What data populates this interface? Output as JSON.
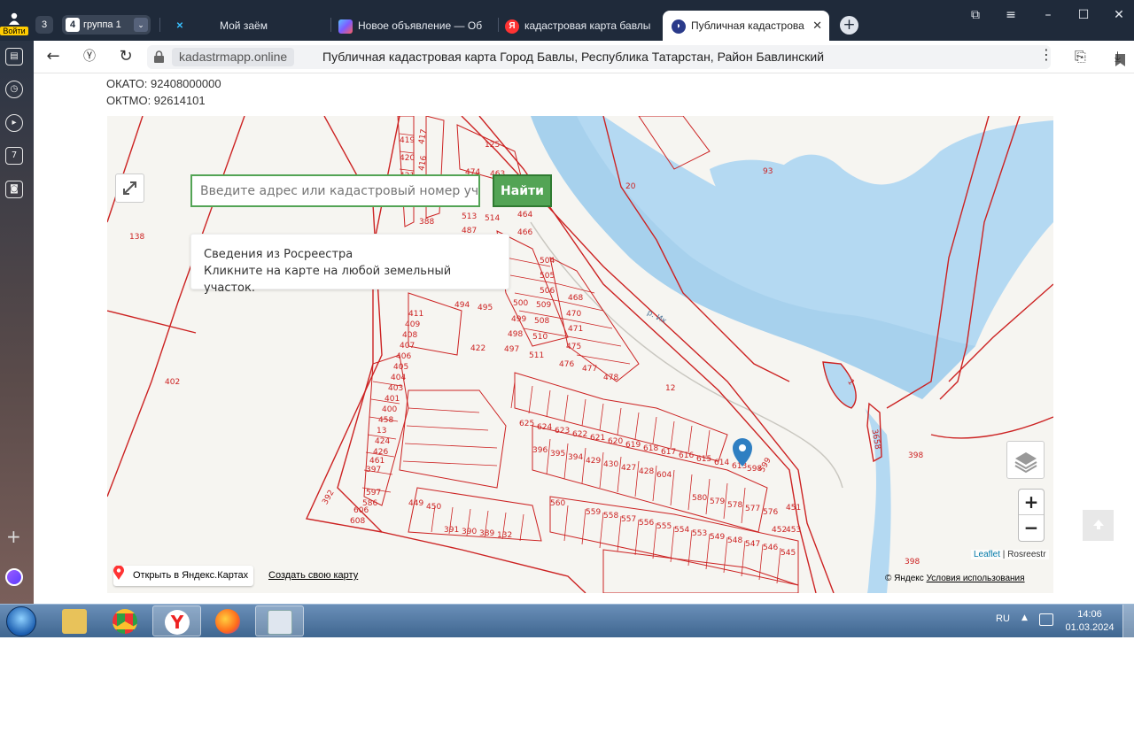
{
  "browser": {
    "login_label": "Войти",
    "tab_count": "3",
    "group": {
      "number": "4",
      "label": "группа 1"
    },
    "tabs": [
      {
        "label": "Мой заём",
        "favicon": "loan-icon"
      },
      {
        "label": "Новое объявление — Об",
        "favicon": "ads-icon"
      },
      {
        "label": "кадастровая карта бавлы",
        "favicon": "yandex-icon"
      },
      {
        "label": "Публичная кадастрова",
        "favicon": "cadastre-icon",
        "active": true
      }
    ],
    "address": {
      "domain": "kadastrmapp.online",
      "title": "Публичная кадастровая карта Город Бавлы, Республика Татарстан, Район Бавлинский"
    }
  },
  "page": {
    "okato": "ОКАТО: 92408000000",
    "oktmo": "ОКТМО: 92614101",
    "search": {
      "placeholder": "Введите адрес или кадастровый номер участка",
      "button": "Найти"
    },
    "info": {
      "title": "Сведения из Росреестра",
      "text": "Кликните на карте на любой земельный участок."
    },
    "map": {
      "zoom_in": "+",
      "zoom_out": "−",
      "attribution_leaflet": "Leaflet",
      "attribution_sep": " | ",
      "attribution_rosreestr": "Rosreestr",
      "open_yandex": "Открыть в Яндекс.Картах",
      "create_map": "Создать свою карту",
      "copyright": "© Яндекс ",
      "terms": "Условия использования",
      "river_label": "р. Ик",
      "plots": [
        {
          "n": "419"
        },
        {
          "n": "420"
        },
        {
          "n": "421"
        },
        {
          "n": "416"
        },
        {
          "n": "417"
        },
        {
          "n": "418"
        },
        {
          "n": "125"
        },
        {
          "n": "474"
        },
        {
          "n": "463"
        },
        {
          "n": "388"
        },
        {
          "n": "513"
        },
        {
          "n": "514"
        },
        {
          "n": "487"
        },
        {
          "n": "488"
        },
        {
          "n": "464"
        },
        {
          "n": "466"
        },
        {
          "n": "465"
        },
        {
          "n": "138"
        },
        {
          "n": "20"
        },
        {
          "n": "93"
        },
        {
          "n": "504"
        },
        {
          "n": "505"
        },
        {
          "n": "506"
        },
        {
          "n": "467"
        },
        {
          "n": "500"
        },
        {
          "n": "509"
        },
        {
          "n": "468"
        },
        {
          "n": "494"
        },
        {
          "n": "495"
        },
        {
          "n": "499"
        },
        {
          "n": "508"
        },
        {
          "n": "470"
        },
        {
          "n": "411"
        },
        {
          "n": "409"
        },
        {
          "n": "469"
        },
        {
          "n": "471"
        },
        {
          "n": "408"
        },
        {
          "n": "498"
        },
        {
          "n": "510"
        },
        {
          "n": "472"
        },
        {
          "n": "407"
        },
        {
          "n": "497"
        },
        {
          "n": "511"
        },
        {
          "n": "475"
        },
        {
          "n": "473"
        },
        {
          "n": "406"
        },
        {
          "n": "422"
        },
        {
          "n": "405"
        },
        {
          "n": "476"
        },
        {
          "n": "477"
        },
        {
          "n": "479"
        },
        {
          "n": "404"
        },
        {
          "n": "423"
        },
        {
          "n": "478"
        },
        {
          "n": "480"
        },
        {
          "n": "403"
        },
        {
          "n": "434"
        },
        {
          "n": "445"
        },
        {
          "n": "456"
        },
        {
          "n": "532"
        },
        {
          "n": "530"
        },
        {
          "n": "528"
        },
        {
          "n": "481"
        },
        {
          "n": "12"
        },
        {
          "n": "1"
        },
        {
          "n": "402"
        },
        {
          "n": "401"
        },
        {
          "n": "400"
        },
        {
          "n": "458"
        },
        {
          "n": "459"
        },
        {
          "n": "460"
        },
        {
          "n": "625"
        },
        {
          "n": "624"
        },
        {
          "n": "623"
        },
        {
          "n": "622"
        },
        {
          "n": "621"
        },
        {
          "n": "620"
        },
        {
          "n": "619"
        },
        {
          "n": "618"
        },
        {
          "n": "617"
        },
        {
          "n": "616"
        },
        {
          "n": "615"
        },
        {
          "n": "614"
        },
        {
          "n": "613"
        },
        {
          "n": "612"
        },
        {
          "n": "611"
        },
        {
          "n": "626"
        },
        {
          "n": "627"
        },
        {
          "n": "628"
        },
        {
          "n": "521"
        },
        {
          "n": "522"
        },
        {
          "n": "523"
        },
        {
          "n": "524"
        },
        {
          "n": "525"
        },
        {
          "n": "526"
        },
        {
          "n": "527"
        },
        {
          "n": "529"
        },
        {
          "n": "531"
        },
        {
          "n": "13"
        },
        {
          "n": "3658"
        },
        {
          "n": "398"
        },
        {
          "n": "462"
        },
        {
          "n": "424"
        },
        {
          "n": "426"
        },
        {
          "n": "461"
        },
        {
          "n": "397"
        },
        {
          "n": "396"
        },
        {
          "n": "395"
        },
        {
          "n": "394"
        },
        {
          "n": "429"
        },
        {
          "n": "430"
        },
        {
          "n": "427"
        },
        {
          "n": "428"
        },
        {
          "n": "604"
        },
        {
          "n": "603"
        },
        {
          "n": "602"
        },
        {
          "n": "601"
        },
        {
          "n": "600"
        },
        {
          "n": "599"
        },
        {
          "n": "598"
        },
        {
          "n": "597"
        },
        {
          "n": "586"
        },
        {
          "n": "606"
        },
        {
          "n": "608"
        },
        {
          "n": "392"
        },
        {
          "n": "391"
        },
        {
          "n": "390"
        },
        {
          "n": "389"
        },
        {
          "n": "132"
        },
        {
          "n": "437"
        },
        {
          "n": "438"
        },
        {
          "n": "439"
        },
        {
          "n": "440"
        },
        {
          "n": "441"
        },
        {
          "n": "442"
        },
        {
          "n": "443"
        },
        {
          "n": "444"
        },
        {
          "n": "435"
        },
        {
          "n": "436"
        },
        {
          "n": "446"
        },
        {
          "n": "581"
        },
        {
          "n": "580"
        },
        {
          "n": "579"
        },
        {
          "n": "578"
        },
        {
          "n": "577"
        },
        {
          "n": "576"
        },
        {
          "n": "575"
        },
        {
          "n": "574"
        },
        {
          "n": "573"
        },
        {
          "n": "572"
        },
        {
          "n": "571"
        },
        {
          "n": "570"
        },
        {
          "n": "592"
        },
        {
          "n": "591"
        },
        {
          "n": "590"
        },
        {
          "n": "589"
        },
        {
          "n": "588"
        },
        {
          "n": "587"
        },
        {
          "n": "569"
        },
        {
          "n": "568"
        },
        {
          "n": "567"
        },
        {
          "n": "447"
        },
        {
          "n": "448"
        },
        {
          "n": "449"
        },
        {
          "n": "450"
        },
        {
          "n": "451"
        },
        {
          "n": "452"
        },
        {
          "n": "453"
        },
        {
          "n": "454"
        },
        {
          "n": "455"
        },
        {
          "n": "639"
        },
        {
          "n": "566"
        },
        {
          "n": "565"
        },
        {
          "n": "564"
        },
        {
          "n": "563"
        },
        {
          "n": "562"
        },
        {
          "n": "561"
        },
        {
          "n": "560"
        },
        {
          "n": "559"
        },
        {
          "n": "558"
        },
        {
          "n": "557"
        },
        {
          "n": "556"
        },
        {
          "n": "555"
        },
        {
          "n": "554"
        },
        {
          "n": "553"
        },
        {
          "n": "549"
        },
        {
          "n": "548"
        },
        {
          "n": "547"
        },
        {
          "n": "546"
        },
        {
          "n": "545"
        },
        {
          "n": "544"
        },
        {
          "n": "543"
        },
        {
          "n": "542"
        },
        {
          "n": "541"
        },
        {
          "n": "540"
        },
        {
          "n": "539"
        },
        {
          "n": "538"
        },
        {
          "n": "537"
        },
        {
          "n": "536"
        },
        {
          "n": "535"
        },
        {
          "n": "551"
        },
        {
          "n": "550"
        },
        {
          "n": "534"
        },
        {
          "n": "533"
        },
        {
          "n": "531"
        },
        {
          "n": "520"
        },
        {
          "n": "422"
        }
      ]
    }
  },
  "taskbar": {
    "lang": "RU",
    "time": "14:06",
    "date": "01.03.2024",
    "apps": [
      "explorer-icon",
      "chrome-icon",
      "yandex-browser-icon",
      "firefox-icon",
      "calculator-icon"
    ]
  },
  "colors": {
    "plot_line": "#cc2222",
    "water": "#b4d9f2",
    "accent_green": "#53a455",
    "marker": "#2f7fc2"
  }
}
